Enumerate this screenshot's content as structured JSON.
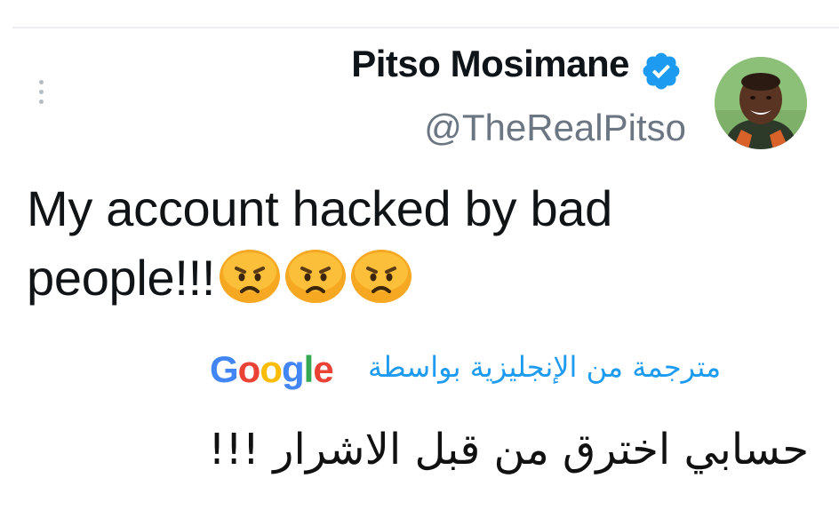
{
  "tweet": {
    "author_name": "Pitso Mosimane",
    "author_handle": "@TheRealPitso",
    "verified": true,
    "text": "My account hacked by bad people!!!",
    "emojis": [
      "frowning-face-icon",
      "frowning-face-icon",
      "frowning-face-icon"
    ]
  },
  "translation": {
    "provider_logo": "Google",
    "translated_by_label": "مترجمة من الإنجليزية بواسطة",
    "translated_text": "حسابي اخترق من قبل الاشرار !!!"
  },
  "colors": {
    "link_blue": "#1d9bf0",
    "handle_gray": "#6b7682",
    "verified_blue": "#1d9bf0",
    "emoji_orange": "#f7a823"
  }
}
